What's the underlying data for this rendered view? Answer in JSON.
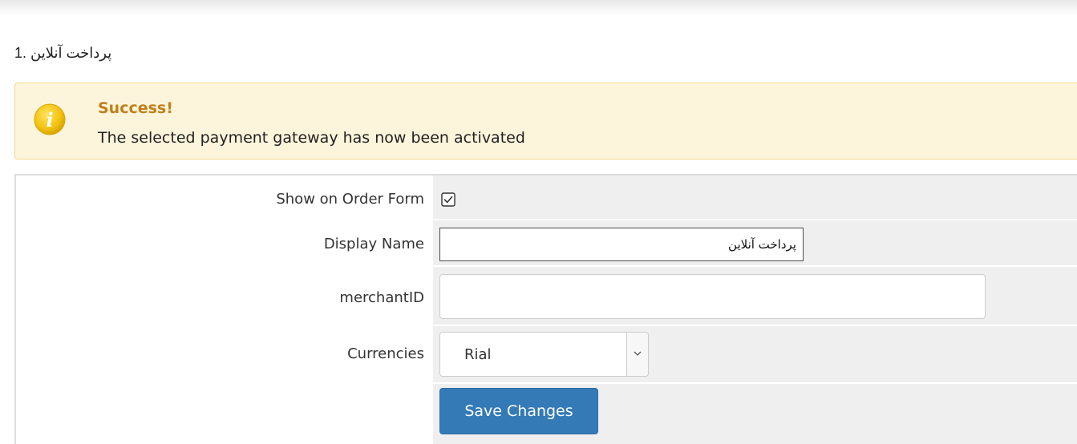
{
  "gateway": {
    "title": "پرداخت آنلاین .1"
  },
  "alert": {
    "icon": "info-icon",
    "heading": "Success!",
    "message": "The selected payment gateway has now been activated",
    "accent_color": "#c07f1a",
    "background_color": "#fcf5dc"
  },
  "form": {
    "show_on_order_form": {
      "label": "Show on Order Form",
      "checked": true
    },
    "display_name": {
      "label": "Display Name",
      "value": "پرداخت آنلاین"
    },
    "merchant_id": {
      "label": "merchantID",
      "value": ""
    },
    "currencies": {
      "label": "Currencies",
      "selected": "Rial"
    },
    "save_label": "Save Changes",
    "button_color": "#337ab7"
  }
}
